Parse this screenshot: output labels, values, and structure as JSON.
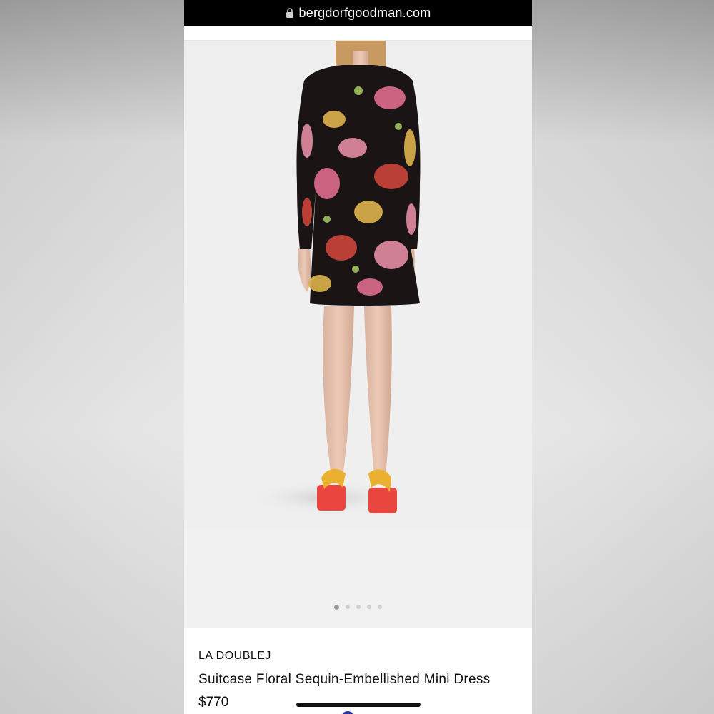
{
  "browser": {
    "url": "bergdorfgoodman.com"
  },
  "product": {
    "brand": "LA DOUBLEJ",
    "name": "Suitcase Floral Sequin-Embellished Mini Dress",
    "price": "$770"
  },
  "gallery": {
    "image_count": 5,
    "active_index": 0,
    "image_description": "Model wearing a black long-sleeve mock-neck mini dress with multicolor floral sequins and red platform sandals with yellow straps"
  },
  "colors": {
    "url_bar_bg": "#000000",
    "page_bg": "#f2f2f2",
    "dress_base": "#1a1414",
    "floral_pink": "#d86a8a",
    "floral_gold": "#d8b04a",
    "floral_red": "#c8443a",
    "sandal_platform": "#e8463f",
    "sandal_strap": "#e9b12f"
  }
}
